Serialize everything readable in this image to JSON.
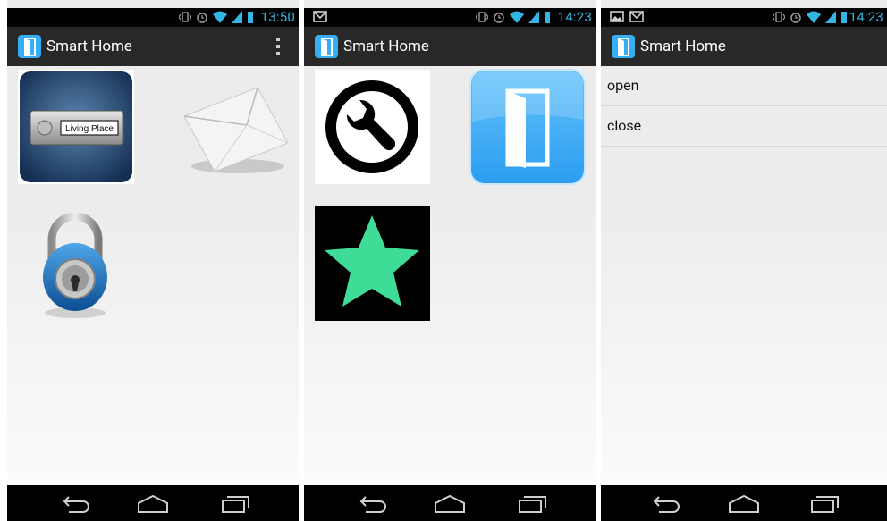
{
  "screens": [
    {
      "time": "13:50",
      "app_title": "Smart Home",
      "overflow_icon": "overflow-menu-icon",
      "tiles": [
        {
          "name": "living-place-doorbell-icon",
          "label": "Living Place"
        },
        {
          "name": "mail-envelope-icon"
        },
        {
          "name": "padlock-icon"
        }
      ]
    },
    {
      "time": "14:23",
      "app_title": "Smart Home",
      "tiles": [
        {
          "name": "wrench-settings-icon"
        },
        {
          "name": "door-icon"
        },
        {
          "name": "star-icon",
          "color": "#3ddc97"
        }
      ]
    },
    {
      "time": "14:23",
      "app_title": "Smart Home",
      "list": [
        "open",
        "close"
      ]
    }
  ],
  "colors": {
    "status_text": "#33b5e5",
    "actionbar": "#282828",
    "door_blue": "#35aef4",
    "star_green": "#3ddc97"
  }
}
